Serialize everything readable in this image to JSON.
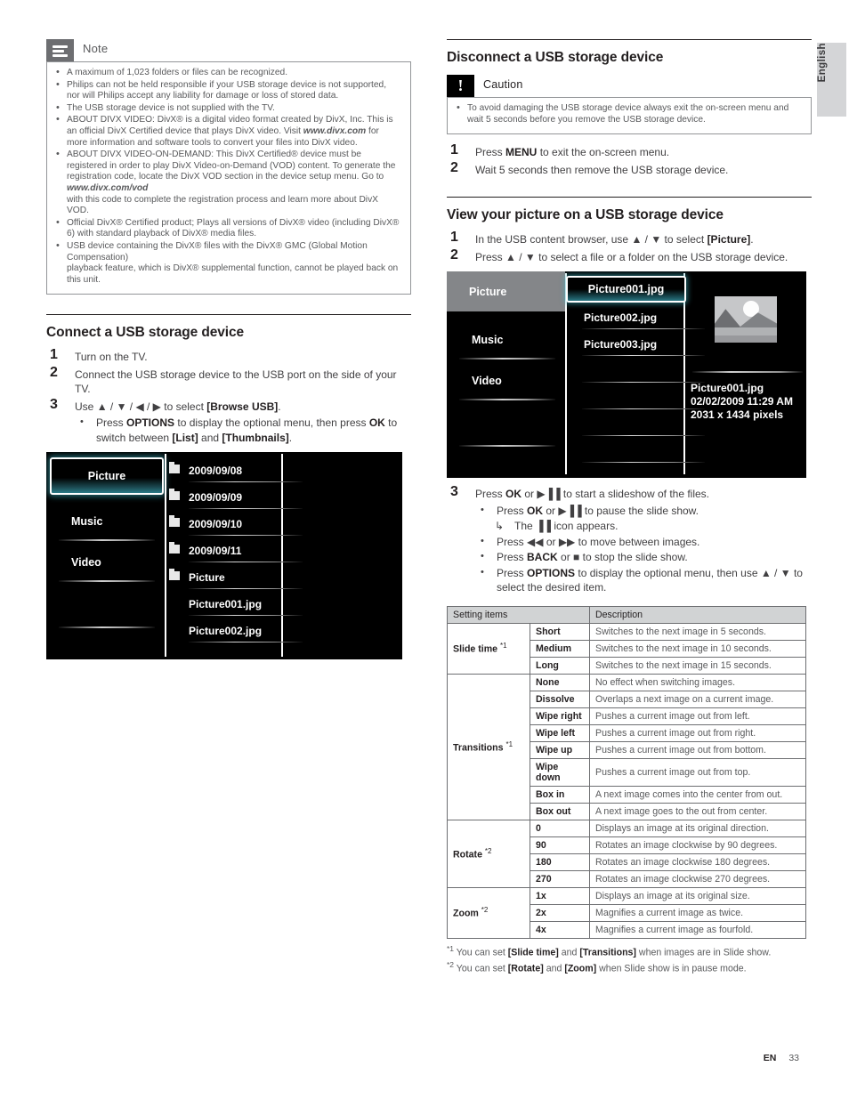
{
  "lang_tab": {
    "label": "English"
  },
  "footer": {
    "lang_code": "EN",
    "page_number": "33"
  },
  "left": {
    "note": {
      "icon": "note-icon",
      "title": "Note",
      "items": [
        {
          "text": "A maximum of 1,023 folders or files can be recognized."
        },
        {
          "text": "Philips can not be held responsible if your USB storage device is not supported, nor will Philips accept any liability for damage or loss of stored data."
        },
        {
          "text": "The USB storage device is not supplied with the TV."
        },
        {
          "text": "ABOUT DIVX VIDEO: DivX® is a digital video format created by DivX, Inc. This is an official DivX Certified device that plays DivX video. Visit ",
          "link": "www.divx.com",
          "text_after": " for more information and software tools to convert your files into DivX video."
        },
        {
          "text": "ABOUT DIVX VIDEO-ON-DEMAND: This DivX Certified® device must be registered in order to play DivX Video-on-Demand (VOD) content. To generate the registration code, locate the DivX VOD section in the device setup menu. Go to ",
          "link": "www.divx.com/vod",
          "text_after": "with this code to complete the registration process and learn more about DivX VOD."
        },
        {
          "text": "Official DivX® Certified product; Plays all versions of DivX® video (including DivX® 6) with standard playback of DivX® media files."
        },
        {
          "text": "USB device containing the DivX® files with the DivX® GMC (Global Motion Compensation)",
          "text_after": "playback feature, which is DivX® supplemental function, cannot be played back on this unit."
        }
      ]
    },
    "connect": {
      "title": "Connect a USB storage device",
      "step1_num": "1",
      "step1": "Turn on the TV.",
      "step2_num": "2",
      "step2": "Connect the USB storage device to the USB port on the side of your TV.",
      "step3_num": "3",
      "step3_pre": "Use ",
      "step3_keys": "▲ / ▼ / ◀ / ▶",
      "step3_mid": " to select ",
      "step3_bold": "[Browse USB]",
      "step3_end": ".",
      "sub1_pre": "Press ",
      "sub1_b1": "OPTIONS",
      "sub1_mid": " to display the optional menu, then press ",
      "sub1_b2": "OK",
      "sub1_mid2": " to switch between ",
      "sub1_b3": "[List]",
      "sub1_mid3": " and ",
      "sub1_b4": "[Thumbnails]",
      "sub1_end": "."
    },
    "tv_screen": {
      "sidebar": [
        {
          "label": "Picture",
          "selected": true
        },
        {
          "label": "Music",
          "selected": false
        },
        {
          "label": "Video",
          "selected": false
        }
      ],
      "files": [
        {
          "name": "2009/09/08",
          "is_folder": true
        },
        {
          "name": "2009/09/09",
          "is_folder": true
        },
        {
          "name": "2009/09/10",
          "is_folder": true
        },
        {
          "name": "2009/09/11",
          "is_folder": true
        },
        {
          "name": "Picture",
          "is_folder": true
        },
        {
          "name": "Picture001.jpg",
          "is_folder": false
        },
        {
          "name": "Picture002.jpg",
          "is_folder": false
        }
      ]
    }
  },
  "right": {
    "disconnect": {
      "title": "Disconnect a USB storage device",
      "caution_icon": "caution-icon",
      "caution_title": "Caution",
      "caution_text": "To avoid damaging the USB storage device always exit the on-screen menu and wait 5 seconds before you remove the USB storage device.",
      "step1_num": "1",
      "step1_pre": "Press ",
      "step1_bold": "MENU",
      "step1_end": " to exit the on-screen menu.",
      "step2_num": "2",
      "step2": "Wait 5 seconds then remove the USB storage device."
    },
    "view": {
      "title": "View your picture on a USB storage device",
      "step1_num": "1",
      "step1_pre": "In the USB content browser, use ",
      "step1_keys": "▲ / ▼",
      "step1_mid": " to select ",
      "step1_bold": "[Picture]",
      "step1_end": ".",
      "step2_num": "2",
      "step2_pre": "Press ",
      "step2_keys": "▲ / ▼",
      "step2_end": " to select a file or a folder on the USB storage device.",
      "step3_num": "3",
      "step3_pre": "Press ",
      "step3_b1": "OK",
      "step3_mid": " or ",
      "step3_icon": "▶▐▐",
      "step3_end": " to start a slideshow of the files.",
      "subs": [
        {
          "pre": "Press ",
          "b": "OK",
          "mid": " or ",
          "icon": "▶▐▐",
          "end": " to pause the slide show."
        },
        {
          "arrow": "↳",
          "pre": "The ",
          "icon": "▐▐",
          "end": " icon appears."
        },
        {
          "pre": "Press ",
          "icon": "◀◀",
          "mid": " or ",
          "icon2": "▶▶",
          "end": " to move between images."
        },
        {
          "pre": "Press ",
          "b": "BACK",
          "mid": " or ",
          "icon": "■",
          "end": " to stop the slide show."
        },
        {
          "pre": "Press ",
          "b": "OPTIONS",
          "mid": " to display the optional menu, then use ",
          "icon": "▲ / ▼",
          "end": " to select the desired item."
        }
      ]
    },
    "tv_screen": {
      "sidebar": [
        {
          "label": "Picture",
          "selected": true
        },
        {
          "label": "Music",
          "selected": false
        },
        {
          "label": "Video",
          "selected": false
        }
      ],
      "files": [
        {
          "name": "Picture001.jpg",
          "selected": true
        },
        {
          "name": "Picture002.jpg",
          "selected": false
        },
        {
          "name": "Picture003.jpg",
          "selected": false
        }
      ],
      "preview": {
        "thumbnail": "picture-thumbnail",
        "filename": "Picture001.jpg",
        "datetime": "02/02/2009 11:29 AM",
        "dimensions": "2031 x 1434 pixels"
      }
    },
    "table": {
      "headers": [
        "Setting items",
        "Description"
      ],
      "groups": [
        {
          "name": "Slide time",
          "footnote": "*1",
          "rows": [
            {
              "option": "Short",
              "description": "Switches to the next image in 5 seconds."
            },
            {
              "option": "Medium",
              "description": "Switches to the next image in 10 seconds."
            },
            {
              "option": "Long",
              "description": "Switches to the next image in 15 seconds."
            }
          ]
        },
        {
          "name": "Transitions",
          "footnote": "*1",
          "rows": [
            {
              "option": "None",
              "description": "No effect when switching images."
            },
            {
              "option": "Dissolve",
              "description": "Overlaps a next image on a current image."
            },
            {
              "option": "Wipe right",
              "description": "Pushes a current image out from left."
            },
            {
              "option": "Wipe left",
              "description": "Pushes a current image out from right."
            },
            {
              "option": "Wipe up",
              "description": "Pushes a current image out from bottom."
            },
            {
              "option": "Wipe down",
              "description": "Pushes a current image out from top."
            },
            {
              "option": "Box in",
              "description": "A next image comes into the center from out."
            },
            {
              "option": "Box out",
              "description": "A next image goes to the out from center."
            }
          ]
        },
        {
          "name": "Rotate",
          "footnote": "*2",
          "rows": [
            {
              "option": "0",
              "description": "Displays an image at its original direction."
            },
            {
              "option": "90",
              "description": "Rotates an image clockwise by 90 degrees."
            },
            {
              "option": "180",
              "description": "Rotates an image clockwise 180 degrees."
            },
            {
              "option": "270",
              "description": "Rotates an image clockwise 270 degrees."
            }
          ]
        },
        {
          "name": "Zoom",
          "footnote": "*2",
          "rows": [
            {
              "option": "1x",
              "description": "Displays an image at its original size."
            },
            {
              "option": "2x",
              "description": "Magnifies a current image as twice."
            },
            {
              "option": "4x",
              "description": "Magnifies a current image as fourfold."
            }
          ]
        }
      ],
      "footnotes": [
        {
          "mark": "*1",
          "pre": " You can set ",
          "b1": "[Slide time]",
          "mid": " and ",
          "b2": "[Transitions]",
          "end": " when images are in Slide show."
        },
        {
          "mark": "*2",
          "pre": " You can set ",
          "b1": "[Rotate]",
          "mid": " and ",
          "b2": "[Zoom]",
          "end": " when Slide show is in pause mode."
        }
      ]
    }
  }
}
